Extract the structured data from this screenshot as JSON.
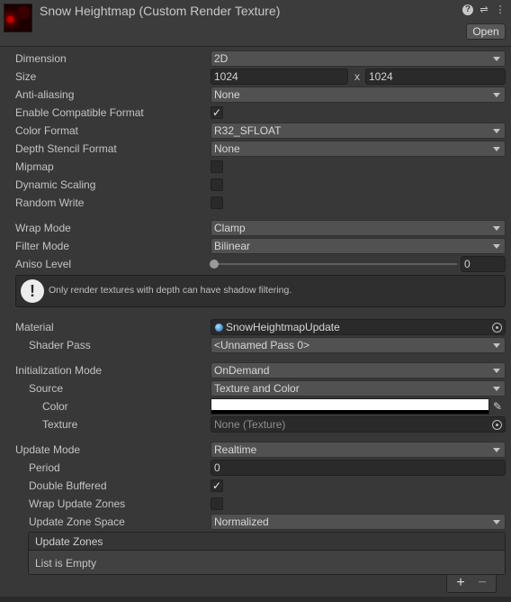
{
  "header": {
    "title": "Snow Heightmap (Custom Render Texture)",
    "open_label": "Open",
    "icons": [
      "help-icon",
      "preset-icon",
      "more-menu-icon"
    ]
  },
  "fields": {
    "dimension": {
      "label": "Dimension",
      "value": "2D"
    },
    "size": {
      "label": "Size",
      "width": "1024",
      "separator": "x",
      "height": "1024"
    },
    "anti_aliasing": {
      "label": "Anti-aliasing",
      "value": "None"
    },
    "enable_compatible_format": {
      "label": "Enable Compatible Format",
      "checked": true
    },
    "color_format": {
      "label": "Color Format",
      "value": "R32_SFLOAT"
    },
    "depth_stencil_format": {
      "label": "Depth Stencil Format",
      "value": "None"
    },
    "mipmap": {
      "label": "Mipmap",
      "checked": false
    },
    "dynamic_scaling": {
      "label": "Dynamic Scaling",
      "checked": false
    },
    "random_write": {
      "label": "Random Write",
      "checked": false
    },
    "wrap_mode": {
      "label": "Wrap Mode",
      "value": "Clamp"
    },
    "filter_mode": {
      "label": "Filter Mode",
      "value": "Bilinear"
    },
    "aniso_level": {
      "label": "Aniso Level",
      "value": "0",
      "slider_fraction": 0
    },
    "info": {
      "text": "Only render textures with depth can have shadow filtering."
    },
    "material": {
      "label": "Material",
      "value": "SnowHeightmapUpdate"
    },
    "shader_pass": {
      "label": "Shader Pass",
      "value": "<Unnamed Pass 0>"
    },
    "initialization_mode": {
      "label": "Initialization Mode",
      "value": "OnDemand"
    },
    "source": {
      "label": "Source",
      "value": "Texture and Color"
    },
    "color": {
      "label": "Color",
      "hex": "#ffffff"
    },
    "texture": {
      "label": "Texture",
      "value": "None (Texture)"
    },
    "update_mode": {
      "label": "Update Mode",
      "value": "Realtime"
    },
    "period": {
      "label": "Period",
      "value": "0"
    },
    "double_buffered": {
      "label": "Double Buffered",
      "checked": true
    },
    "wrap_update_zones": {
      "label": "Wrap Update Zones",
      "checked": false
    },
    "update_zone_space": {
      "label": "Update Zone Space",
      "value": "Normalized"
    },
    "update_zones": {
      "header": "Update Zones",
      "empty_text": "List is Empty",
      "add_label": "+",
      "remove_label": "−"
    }
  },
  "colors": {
    "background": "#383838",
    "header": "#3c3c3c",
    "field_dark": "#2a2a2a",
    "dropdown": "#515151",
    "text": "#c4c4c4"
  }
}
